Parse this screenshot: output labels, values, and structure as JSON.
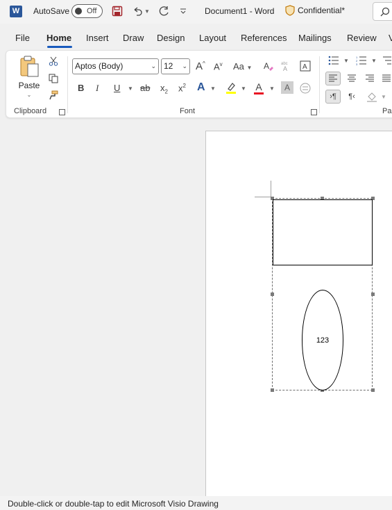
{
  "titlebar": {
    "logo_letter": "W",
    "autosave_label": "AutoSave",
    "autosave_state": "Off",
    "doc_title": "Document1  -  Word",
    "confidential_label": "Confidential*"
  },
  "tabs": [
    "File",
    "Home",
    "Insert",
    "Draw",
    "Design",
    "Layout",
    "References",
    "Mailings",
    "Review",
    "V"
  ],
  "ribbon": {
    "clipboard": {
      "paste_label": "Paste",
      "group_label": "Clipboard"
    },
    "font": {
      "font_name": "Aptos (Body)",
      "font_size": "12",
      "group_label": "Font",
      "bold": "B",
      "italic": "I",
      "underline": "U",
      "strikethrough": "ab",
      "subscript": "x",
      "superscript": "x",
      "grow": "A",
      "shrink": "A",
      "change_case": "Aa",
      "text_effects": "A",
      "font_color": "A",
      "shading": "A",
      "highlight_color": "#ffff00",
      "font_color_swatch": "#e81123"
    },
    "paragraph": {
      "group_label": "Pa"
    }
  },
  "document": {
    "ellipse_text": "123"
  },
  "statusbar": {
    "text": "Double-click or double-tap to edit Microsoft Visio Drawing"
  },
  "colors": {
    "accent": "#185abd",
    "word_blue": "#2b579a"
  }
}
